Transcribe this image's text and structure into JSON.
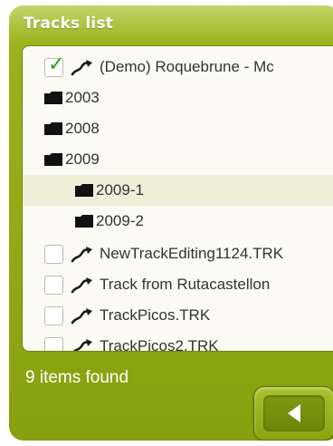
{
  "window": {
    "title": "Tracks list"
  },
  "list": {
    "items": [
      {
        "label": "(Demo) Roquebrune - Mc",
        "kind": "track",
        "checked": true
      },
      {
        "label": "2003",
        "kind": "folder"
      },
      {
        "label": "2008",
        "kind": "folder"
      },
      {
        "label": "2009",
        "kind": "folder"
      },
      {
        "label": "2009-1",
        "kind": "folder",
        "selected": true
      },
      {
        "label": "2009-2",
        "kind": "folder"
      },
      {
        "label": "NewTrackEditing1124.TRK",
        "kind": "track",
        "checked": false
      },
      {
        "label": "Track from Rutacastellon",
        "kind": "track",
        "checked": false
      },
      {
        "label": "TrackPicos.TRK",
        "kind": "track",
        "checked": false
      },
      {
        "label": "TrackPicos2.TRK",
        "kind": "track",
        "checked": false
      }
    ]
  },
  "status": {
    "text": "9 items found"
  },
  "icons": {
    "check": "checkmark-icon",
    "track": "track-route-icon",
    "folder": "folder-icon",
    "back": "back-arrow-icon"
  },
  "colors": {
    "panel": "#95ad18",
    "check": "#2d9c1c",
    "selected_row": "#efefd9"
  }
}
